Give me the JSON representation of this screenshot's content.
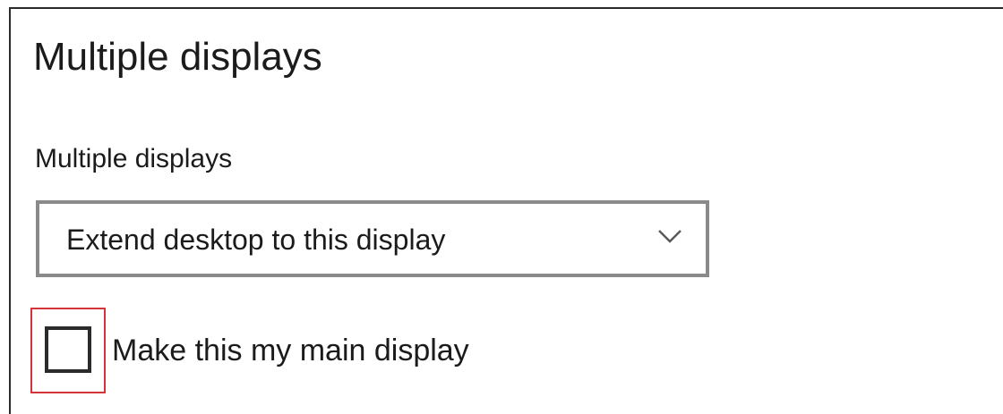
{
  "page": {
    "title": "Multiple displays"
  },
  "multiple_displays": {
    "label": "Multiple displays",
    "dropdown": {
      "selected_value": "Extend desktop to this display",
      "icon": "chevron-down-icon"
    },
    "main_display_checkbox": {
      "label": "Make this my main display",
      "checked": false,
      "highlight_color": "#d3343a"
    }
  }
}
